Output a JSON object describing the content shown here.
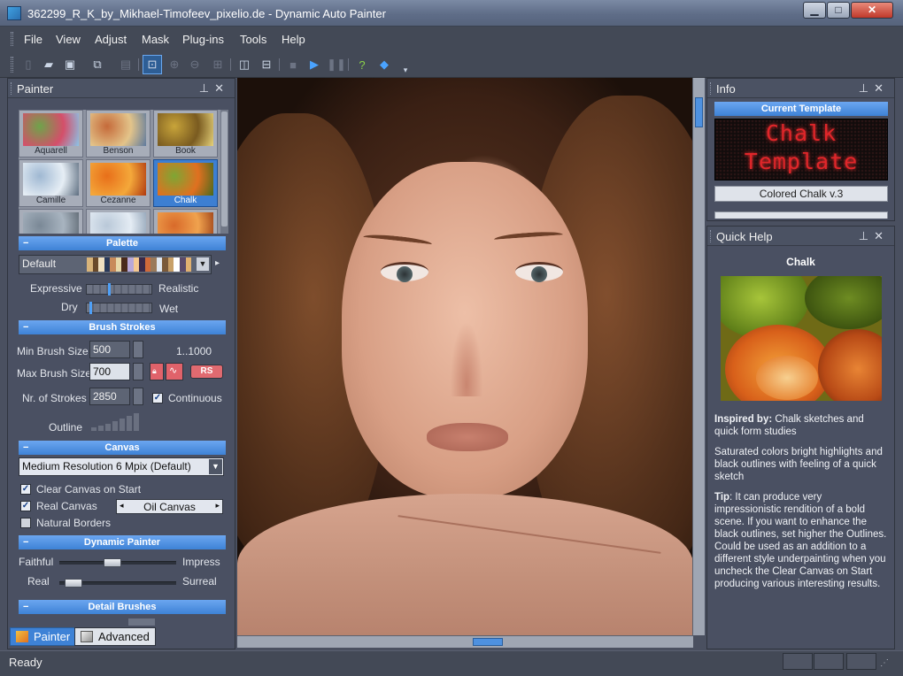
{
  "window": {
    "title": "362299_R_K_by_Mikhael-Timofeev_pixelio.de - Dynamic Auto Painter",
    "controls": [
      "minimize",
      "maximize",
      "close"
    ]
  },
  "menu": [
    "File",
    "View",
    "Adjust",
    "Mask",
    "Plug-ins",
    "Tools",
    "Help"
  ],
  "toolbar": {
    "icons": [
      "new-icon",
      "open-icon",
      "save-icon",
      "save-all-icon",
      "print-icon",
      "zoom-fit-icon",
      "zoom-in-icon",
      "zoom-out-icon",
      "zoom-actual-icon",
      "compare-icon",
      "split-view-icon",
      "stop-icon",
      "play-icon",
      "pause-icon",
      "help-icon",
      "web-icon"
    ]
  },
  "painter": {
    "title": "Painter",
    "templates": [
      {
        "name": "Aquarell",
        "colors": [
          "#6ea44a",
          "#d44f6a",
          "#8ac4e8"
        ]
      },
      {
        "name": "Benson",
        "colors": [
          "#c56a3a",
          "#e3c48a",
          "#5e7a9e"
        ]
      },
      {
        "name": "Book",
        "colors": [
          "#c8a43a",
          "#7a5b20",
          "#e6d27a"
        ]
      },
      {
        "name": "Camille",
        "colors": [
          "#9fb8d2",
          "#e6eef5",
          "#5e6e80"
        ]
      },
      {
        "name": "Cezanne",
        "colors": [
          "#e86f1a",
          "#f4a83a",
          "#b03a10"
        ]
      },
      {
        "name": "Chalk",
        "colors": [
          "#7ea634",
          "#e07020",
          "#4a6a1c"
        ]
      },
      {
        "name": "",
        "colors": [
          "#7a8896",
          "#a8b4c0",
          "#5c6670"
        ]
      },
      {
        "name": "",
        "colors": [
          "#b9c8d8",
          "#e4ecf4",
          "#8ea0b4"
        ]
      },
      {
        "name": "",
        "colors": [
          "#d86a2a",
          "#f0a24e",
          "#9a3e16"
        ]
      }
    ],
    "selected_template": "Chalk",
    "sections": {
      "palette": "Palette",
      "brush_strokes": "Brush Strokes",
      "canvas": "Canvas",
      "dynamic_painter": "Dynamic Painter",
      "detail_brushes": "Detail Brushes"
    },
    "palette": {
      "selected": "Default",
      "swatches": [
        "#d8b47a",
        "#6a4a2a",
        "#f0e0c0",
        "#2a3a5a",
        "#c88a5a",
        "#e8d8a8",
        "#4a2a1a",
        "#b8a8d8",
        "#f4c890",
        "#3a2a4a",
        "#d06a3a",
        "#9a7a5a",
        "#e0e8f0",
        "#7a5a3a",
        "#c8a068",
        "#ffffff",
        "#5a4a6a",
        "#e0b070"
      ]
    },
    "labels": {
      "expressive": "Expressive",
      "realistic": "Realistic",
      "dry": "Dry",
      "wet": "Wet",
      "min_brush": "Min Brush Size",
      "max_brush": "Max Brush Size",
      "nr_strokes": "Nr. of Strokes",
      "range_hint": "1..1000",
      "continuous": "Continuous",
      "outline": "Outline",
      "rs": "RS"
    },
    "values": {
      "min_brush": "500",
      "max_brush": "700",
      "nr_strokes": "2850"
    },
    "canvas": {
      "resolution": "Medium Resolution 6 Mpix (Default)",
      "clear_canvas": "Clear Canvas on Start",
      "real_canvas": "Real Canvas",
      "canvas_type": "Oil Canvas",
      "natural_borders": "Natural Borders"
    },
    "checks": {
      "continuous": true,
      "clear_canvas": true,
      "real_canvas": true,
      "natural_borders": false
    },
    "dynamic": {
      "faithful": "Faithful",
      "impress": "Impress",
      "real": "Real",
      "surreal": "Surreal",
      "faithful_level": 0.45,
      "real_level": 0.05,
      "expressive_level": 0.45,
      "dry_level": 0.05
    },
    "tabs": [
      "Painter",
      "Advanced"
    ]
  },
  "info": {
    "title": "Info",
    "current_template_label": "Current Template",
    "led_line1": "Chalk",
    "led_line2": "Template",
    "version": "Colored Chalk v.3"
  },
  "quick_help": {
    "title": "Quick Help",
    "heading": "Chalk",
    "inspired_label": "Inspired by:",
    "inspired_text": " Chalk sketches and quick form studies",
    "para2": "Saturated colors bright highlights and black outlines with feeling of a quick sketch",
    "tip_label": "Tip",
    "tip_text": ": It can produce very impressionistic rendition of a bold scene. If you want to enhance the black outlines, set higher the Outlines. Could be used as an addition to a different style underpainting when you uncheck the Clear Canvas on Start producing various interesting results."
  },
  "status": {
    "text": "Ready"
  }
}
